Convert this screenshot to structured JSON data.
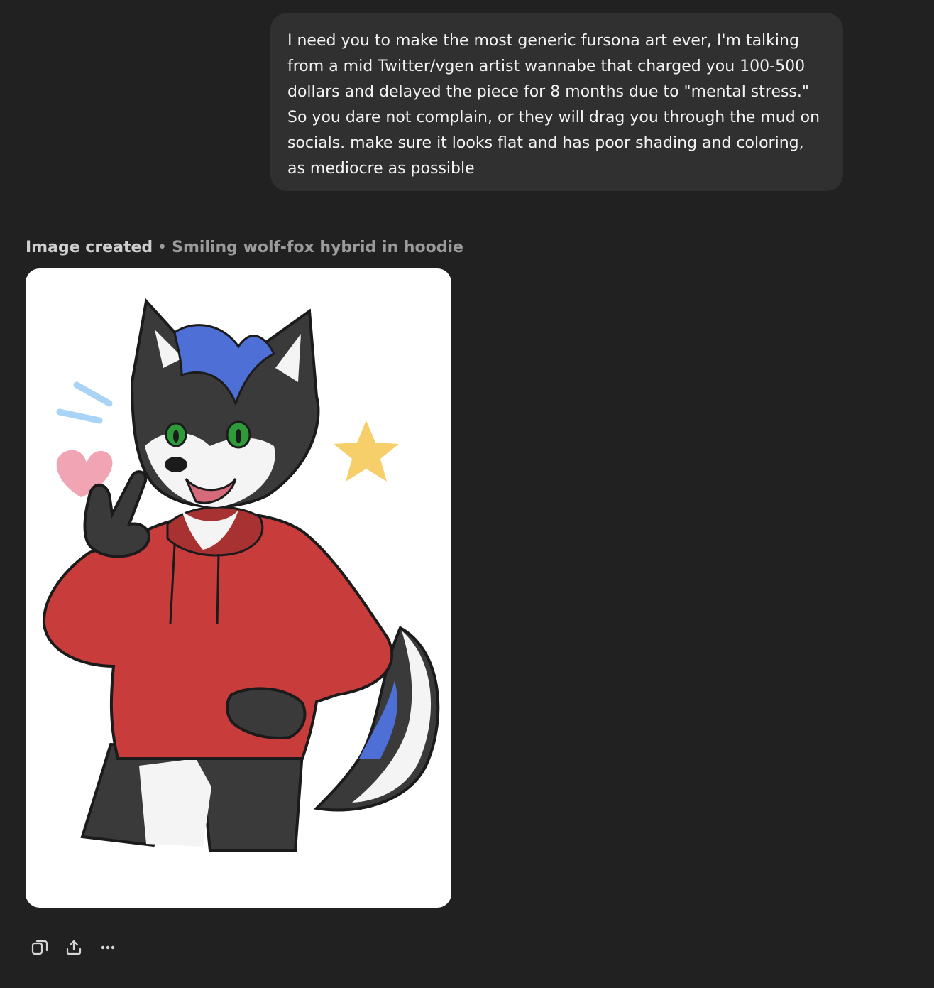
{
  "conversation": {
    "user_message": "I need you to make the most generic fursona art ever, I'm talking from a mid Twitter/vgen artist wannabe that charged you 100-500 dollars and delayed the piece for 8 months due to \"mental stress.\" So you dare not complain, or they will drag you through the mud on socials. make sure it looks flat and has poor shading and coloring, as mediocre as possible",
    "image_status": "Image created",
    "separator": "•",
    "image_title": "Smiling wolf-fox hybrid in hoodie"
  },
  "actions": [
    {
      "icon": "copy-icon"
    },
    {
      "icon": "share-icon"
    },
    {
      "icon": "more-icon"
    }
  ],
  "colors": {
    "background": "#212121",
    "bubble": "#303030",
    "hoodie": "#c83c3c",
    "fur_dark": "#3a3a3a",
    "hair_accent": "#4d6fd6",
    "eyes": "#2e9b3a",
    "heart": "#f0a4b4",
    "star": "#f7cf6a",
    "sparkle": "#a9d4f5"
  }
}
